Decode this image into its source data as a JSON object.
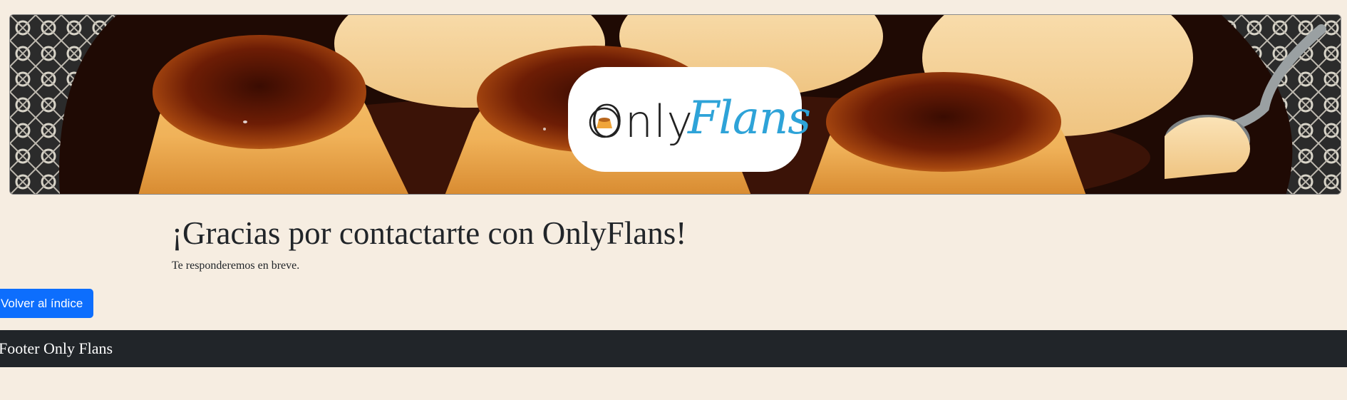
{
  "banner": {
    "image_alt": "flan banner",
    "logo": {
      "only_text": "Only",
      "flans_text": "Flans",
      "only_color": "#222222",
      "flans_color": "#2ea3d8"
    }
  },
  "main": {
    "title": "¡Gracias por contactarte con OnlyFlans!",
    "subtitle": "Te responderemos en breve."
  },
  "actions": {
    "back_label": "Volver al índice",
    "back_color": "#0d6efd"
  },
  "footer": {
    "text": "Footer Only Flans",
    "background": "#212529"
  }
}
